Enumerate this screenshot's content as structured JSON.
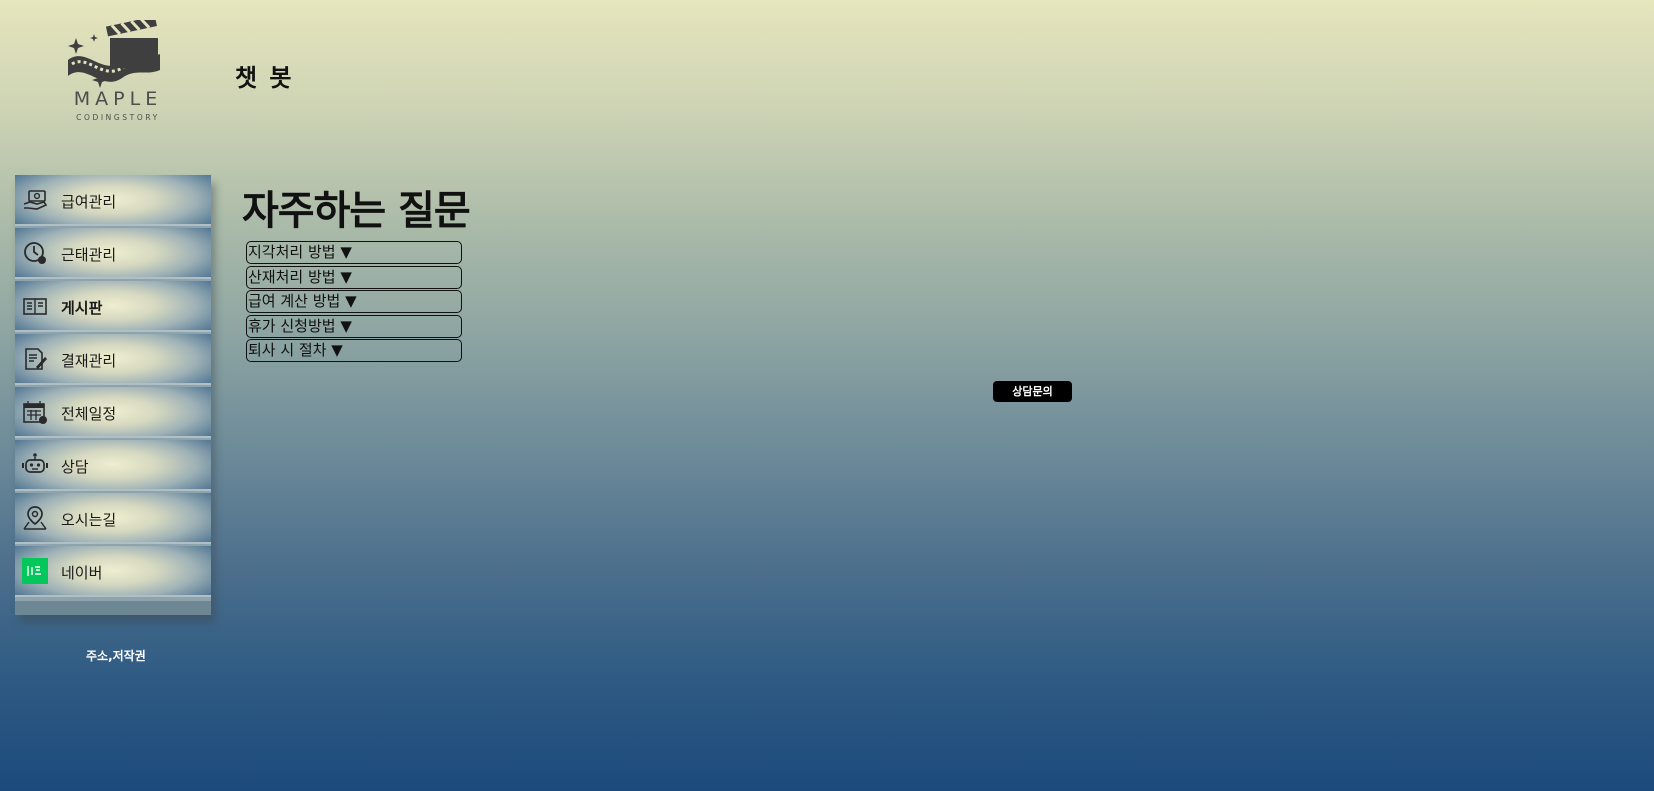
{
  "logo": {
    "name": "MAPLE",
    "tagline": "CODINGSTORY",
    "icon": "clapperboard-film-logo"
  },
  "header": {
    "title": "챗 봇"
  },
  "sidebar": {
    "items": [
      {
        "label": "급여관리",
        "icon": "money-hand-icon"
      },
      {
        "label": "근태관리",
        "icon": "clock-icon"
      },
      {
        "label": "게시판",
        "icon": "board-icon",
        "active": true
      },
      {
        "label": "결재관리",
        "icon": "document-sign-icon"
      },
      {
        "label": "전체일정",
        "icon": "calendar-icon"
      },
      {
        "label": "상담",
        "icon": "robot-chat-icon"
      },
      {
        "label": "오시는길",
        "icon": "map-pin-icon"
      },
      {
        "label": "네이버",
        "icon": "naver-logo-icon"
      }
    ],
    "footer": "주소,저작권"
  },
  "main": {
    "faq_title": "자주하는 질문",
    "faq_items": [
      "지각처리 방법 ▼",
      "산재처리 방법 ▼",
      "급여 계산 방법 ▼",
      "휴가 신청방법 ▼",
      "퇴사 시 절차 ▼"
    ],
    "consult_button": "상담문의"
  },
  "colors": {
    "background_top": "#e6e6bd",
    "background_bottom": "#1c4a7c",
    "naver_green": "#03c75a",
    "button_bg": "#000000"
  }
}
